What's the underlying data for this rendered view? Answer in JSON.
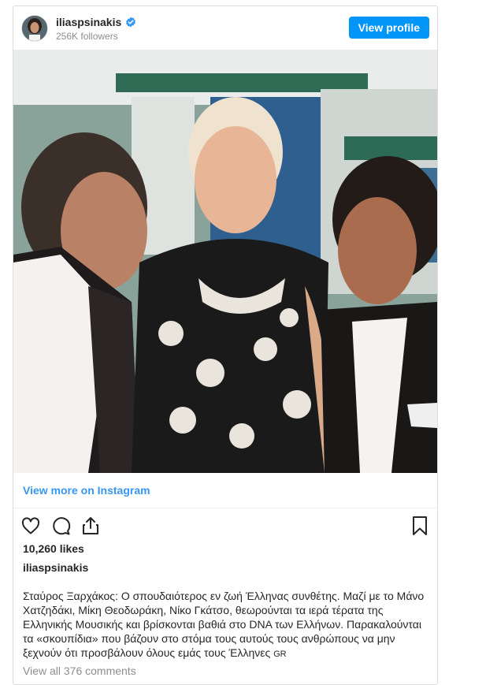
{
  "profile": {
    "username": "iliaspsinakis",
    "followers": "256K followers",
    "view_profile_label": "View profile",
    "verified_icon": "verified-badge-icon"
  },
  "media": {
    "description_icon": "photo"
  },
  "links": {
    "view_more": "View more on Instagram",
    "view_comments": "View all 376 comments"
  },
  "actions": {
    "like_icon": "heart-icon",
    "comment_icon": "comment-icon",
    "share_icon": "share-icon",
    "save_icon": "bookmark-icon"
  },
  "stats": {
    "likes": "10,260 likes"
  },
  "caption": {
    "user": "iliaspsinakis",
    "text": "Σταύρος Ξαρχάκος: Ο σπουδαιότερος εν ζωή Έλληνας συνθέτης. Μαζί με το Μάνο Χατζηδάκι, Μίκη Θεοδωράκη, Νίκο Γκάτσο, θεωρούνται τα ιερά τέρατα της Ελληνικής Μουσικής και βρίσκονται βαθιά στο DNA των Ελλήνων. Παρακαλούνται τα «σκουπίδια» που βάζουν στο στόμα τους αυτούς τους ανθρώπους να μην ξεχνούν ότι προσβάλουν όλους εμάς τους Έλληνες",
    "flag": "GR"
  },
  "colors": {
    "accent": "#0095f6",
    "link": "#3897f0",
    "muted": "#8e8e8e",
    "border": "#dbdbdb"
  }
}
